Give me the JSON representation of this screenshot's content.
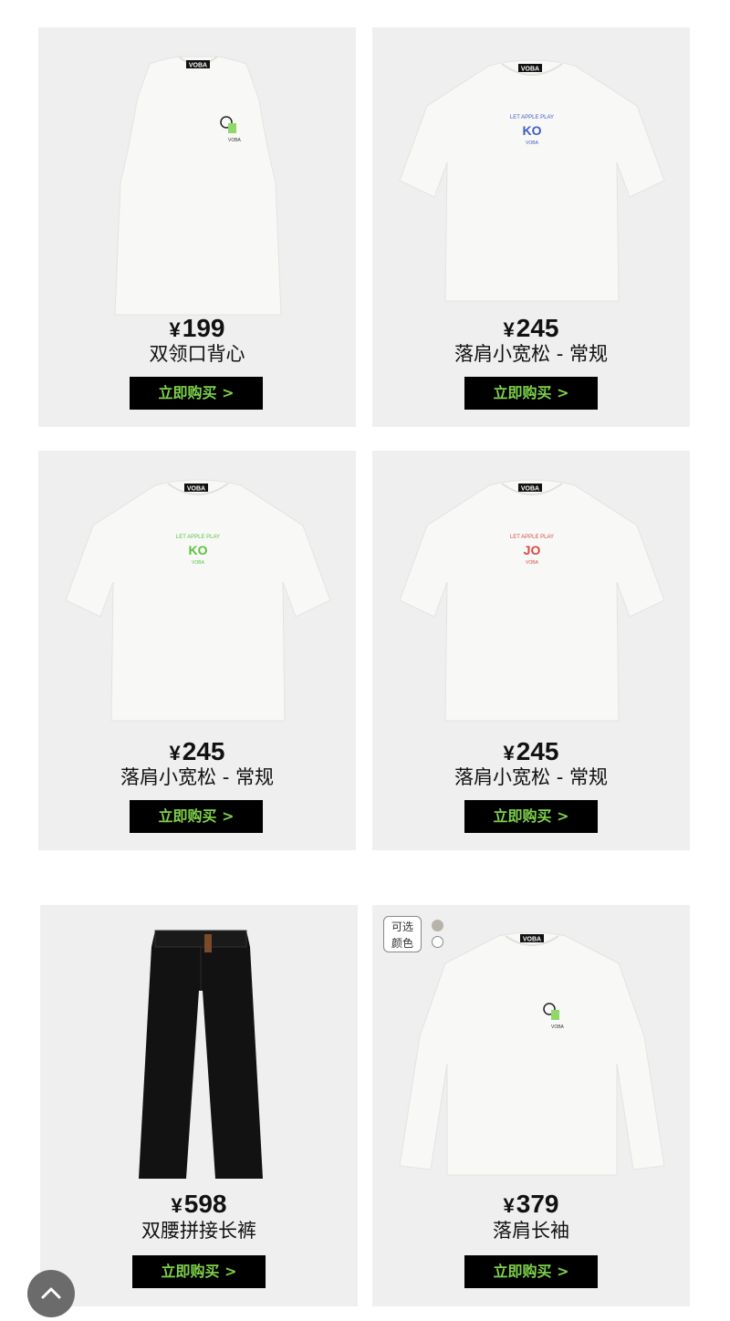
{
  "products": [
    {
      "price": "199",
      "name": "双领口背心",
      "buy_label": "立即购买 >",
      "image": "white-tank-top-image"
    },
    {
      "price": "245",
      "name": "落肩小宽松 - 常规",
      "buy_label": "立即购买 >",
      "image": "white-tshirt-blue-print-image"
    },
    {
      "price": "245",
      "name": "落肩小宽松 - 常规",
      "buy_label": "立即购买 >",
      "image": "white-tshirt-green-print-image"
    },
    {
      "price": "245",
      "name": "落肩小宽松 - 常规",
      "buy_label": "立即购买 >",
      "image": "white-tshirt-red-print-image"
    },
    {
      "price": "598",
      "name": "双腰拼接长裤",
      "buy_label": "立即购买 >",
      "image": "black-pants-image"
    },
    {
      "price": "379",
      "name": "落肩长袖",
      "buy_label": "立即购买 >",
      "image": "white-longsleeve-image"
    }
  ],
  "currency_symbol": "¥",
  "brand_tag": "VOBA",
  "color_option": {
    "label_line1": "可选",
    "label_line2": "颜色",
    "swatches": [
      "#b8b3a8",
      "#ffffff"
    ]
  },
  "scroll_top_icon": "chevron-up-icon",
  "colors": {
    "buy_bg": "#000000",
    "buy_text": "#7ed24a",
    "card_bg": "#efefef"
  }
}
